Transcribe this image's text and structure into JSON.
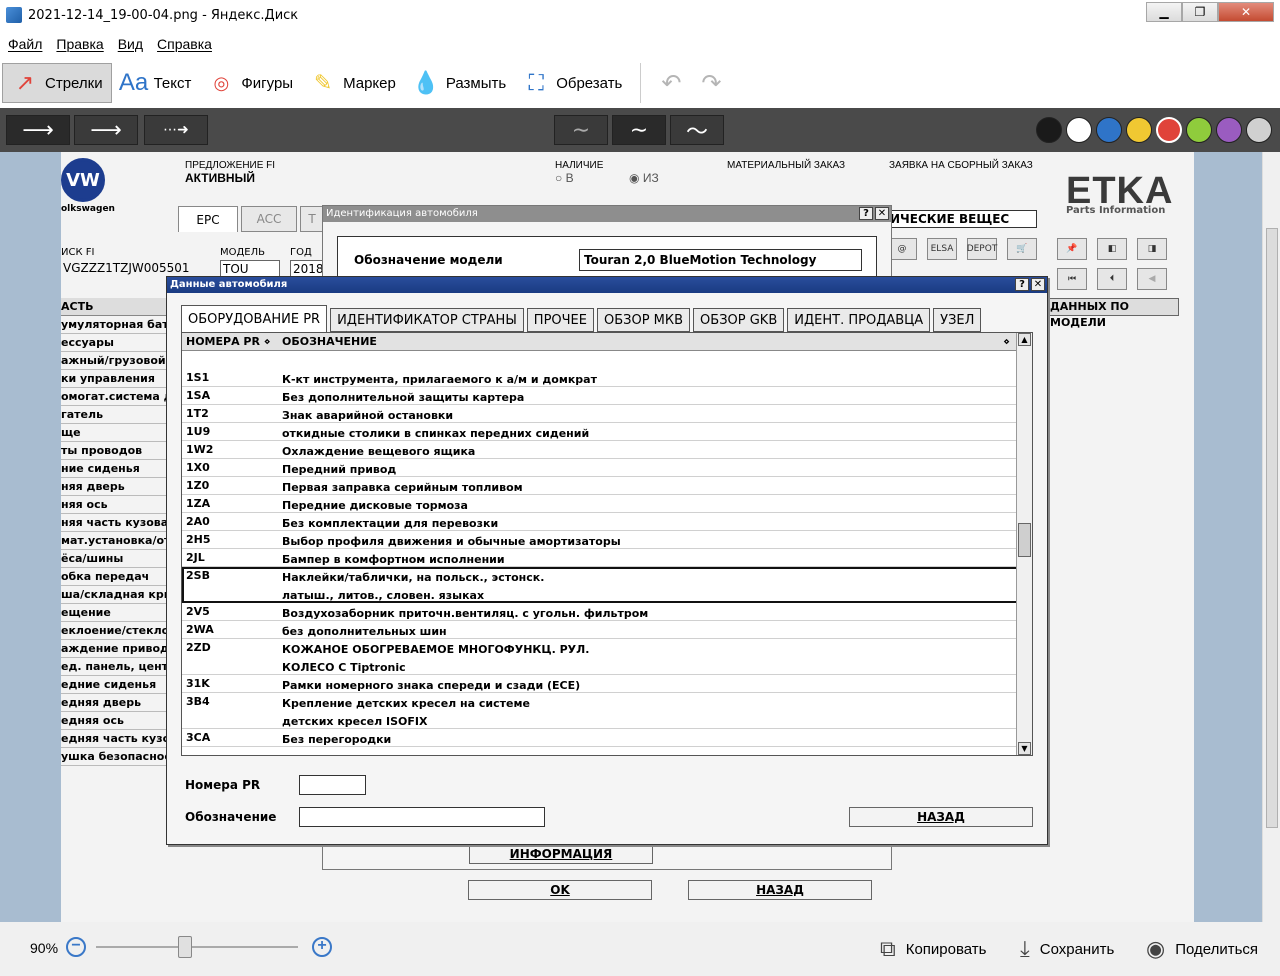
{
  "window": {
    "title": "2021-12-14_19-00-04.png - Яндекс.Диск"
  },
  "menu": [
    "Файл",
    "Правка",
    "Вид",
    "Справка"
  ],
  "toolbar": {
    "arrows": "Стрелки",
    "text": "Текст",
    "shapes": "Фигуры",
    "marker": "Маркер",
    "blur": "Размыть",
    "crop": "Обрезать"
  },
  "swatches": [
    "#1a1a1a",
    "#ffffff",
    "#2f74c8",
    "#f0c832",
    "#e0433a",
    "#8fcc3c",
    "#9a5cc0",
    "#d0d0d0"
  ],
  "etka": {
    "proposal_label": "ПРЕДЛОЖЕНИЕ FI",
    "proposal_value": "АКТИВНЫЙ",
    "availability_label": "НАЛИЧИЕ",
    "avail_opt1": "В",
    "avail_opt2": "ИЗ",
    "material_order": "МАТЕРИАЛЬНЫЙ ЗАКАЗ",
    "assembly_order": "ЗАЯВКА НА СБОРНЫЙ ЗАКАЗ",
    "logo": "ETKA",
    "logo_sub": "Parts Information",
    "brand": "olkswagen",
    "tab_epc": "EPC",
    "tab_acc": "ACC",
    "tab_t": "T",
    "chem_tab": "ИЧЕСКИЕ ВЕЩЕС",
    "search_label": "ИСК FI",
    "vin": "VGZZZ1TZJW005501",
    "model_label": "МОДЕЛЬ",
    "model_value": "TOU",
    "year_label": "ГОД",
    "year_value": "2018",
    "right_header": "ДАННЫХ ПО МОДЕЛИ",
    "left_header": "АСТЬ",
    "left_items": [
      "умуляторная бата",
      "ессуары",
      "ажный/грузовой о",
      "ки управления",
      "омогат.система дл",
      "гатель",
      "ще",
      "ты проводов",
      "ние сиденья",
      "няя дверь",
      "няя ось",
      "няя часть кузова",
      "мат.установка/ото",
      "ёса/шины",
      "обка передач",
      "ша/складная кры",
      "ещение",
      "еклоение/стеклооч",
      "аждение привода",
      "ед. панель, центр",
      "едние сиденья",
      "едняя дверь",
      "едняя ось",
      "едняя часть кузо",
      "ушка безопасност"
    ],
    "icon_elsa": "ELSA",
    "icon_depot": "DEPOT"
  },
  "ident_dialog": {
    "title": "Идентификация автомобиля",
    "model_label": "Обозначение модели",
    "model_value": "Touran 2,0 BlueMotion Technology",
    "info_btn": "ИНФОРМАЦИЯ",
    "ok_btn": "OK",
    "back_btn": "НАЗАД"
  },
  "data_dialog": {
    "title": "Данные автомобиля",
    "tabs": [
      "ОБОРУДОВАНИЕ PR",
      "ИДЕНТИФИКАТОР СТРАНЫ",
      "ПРОЧЕЕ",
      "ОБЗОР МКВ",
      "ОБЗОР GKB",
      "ИДЕНТ. ПРОДАВЦА",
      "УЗЕЛ"
    ],
    "col_code": "НОМЕРА PR",
    "col_desc": "ОБОЗНАЧЕНИЕ",
    "rows": [
      {
        "code": "1S1",
        "desc": "К-кт инструмента, прилагаемого к а/м и домкрат"
      },
      {
        "code": "1SA",
        "desc": "Без дополнительной защиты картера"
      },
      {
        "code": "1T2",
        "desc": "Знак аварийной остановки"
      },
      {
        "code": "1U9",
        "desc": "откидные столики в спинках передних сидений"
      },
      {
        "code": "1W2",
        "desc": "Охлаждение вещевого ящика"
      },
      {
        "code": "1X0",
        "desc": "Передний привод"
      },
      {
        "code": "1Z0",
        "desc": "Первая заправка серийным топливом"
      },
      {
        "code": "1ZA",
        "desc": "Передние дисковые тормоза"
      },
      {
        "code": "2A0",
        "desc": "Без комплектации для перевозки"
      },
      {
        "code": "2H5",
        "desc": "Выбор профиля движения и обычные амортизаторы"
      },
      {
        "code": "2JL",
        "desc": "Бампер в комфортном исполнении"
      },
      {
        "code": "2SB",
        "desc": "Наклейки/таблички, на польск., эстонск.",
        "desc2": "латыш., литов., словен. языках",
        "selected": true
      },
      {
        "code": "2V5",
        "desc": "Воздухозаборник приточн.вентиляц. с угольн. фильтром"
      },
      {
        "code": "2WA",
        "desc": "без дополнительных шин"
      },
      {
        "code": "2ZD",
        "desc": "КОЖАНОЕ ОБОГРЕВАЕМОЕ МНОГОФУНКЦ. РУЛ.",
        "desc2": "КОЛЕСО С Tiptronic"
      },
      {
        "code": "31K",
        "desc": "Рамки номерного знака спереди и сзади (ECE)"
      },
      {
        "code": "3B4",
        "desc": "Крепление детских кресел на системе",
        "desc2": "детских кресел ISOFIX"
      },
      {
        "code": "3CA",
        "desc": "Без перегородки"
      }
    ],
    "pr_label": "Номера PR",
    "desc_label": "Обозначение",
    "back_btn": "НАЗАД"
  },
  "bottom": {
    "zoom": "90%",
    "copy": "Копировать",
    "save": "Сохранить",
    "share": "Поделиться"
  }
}
